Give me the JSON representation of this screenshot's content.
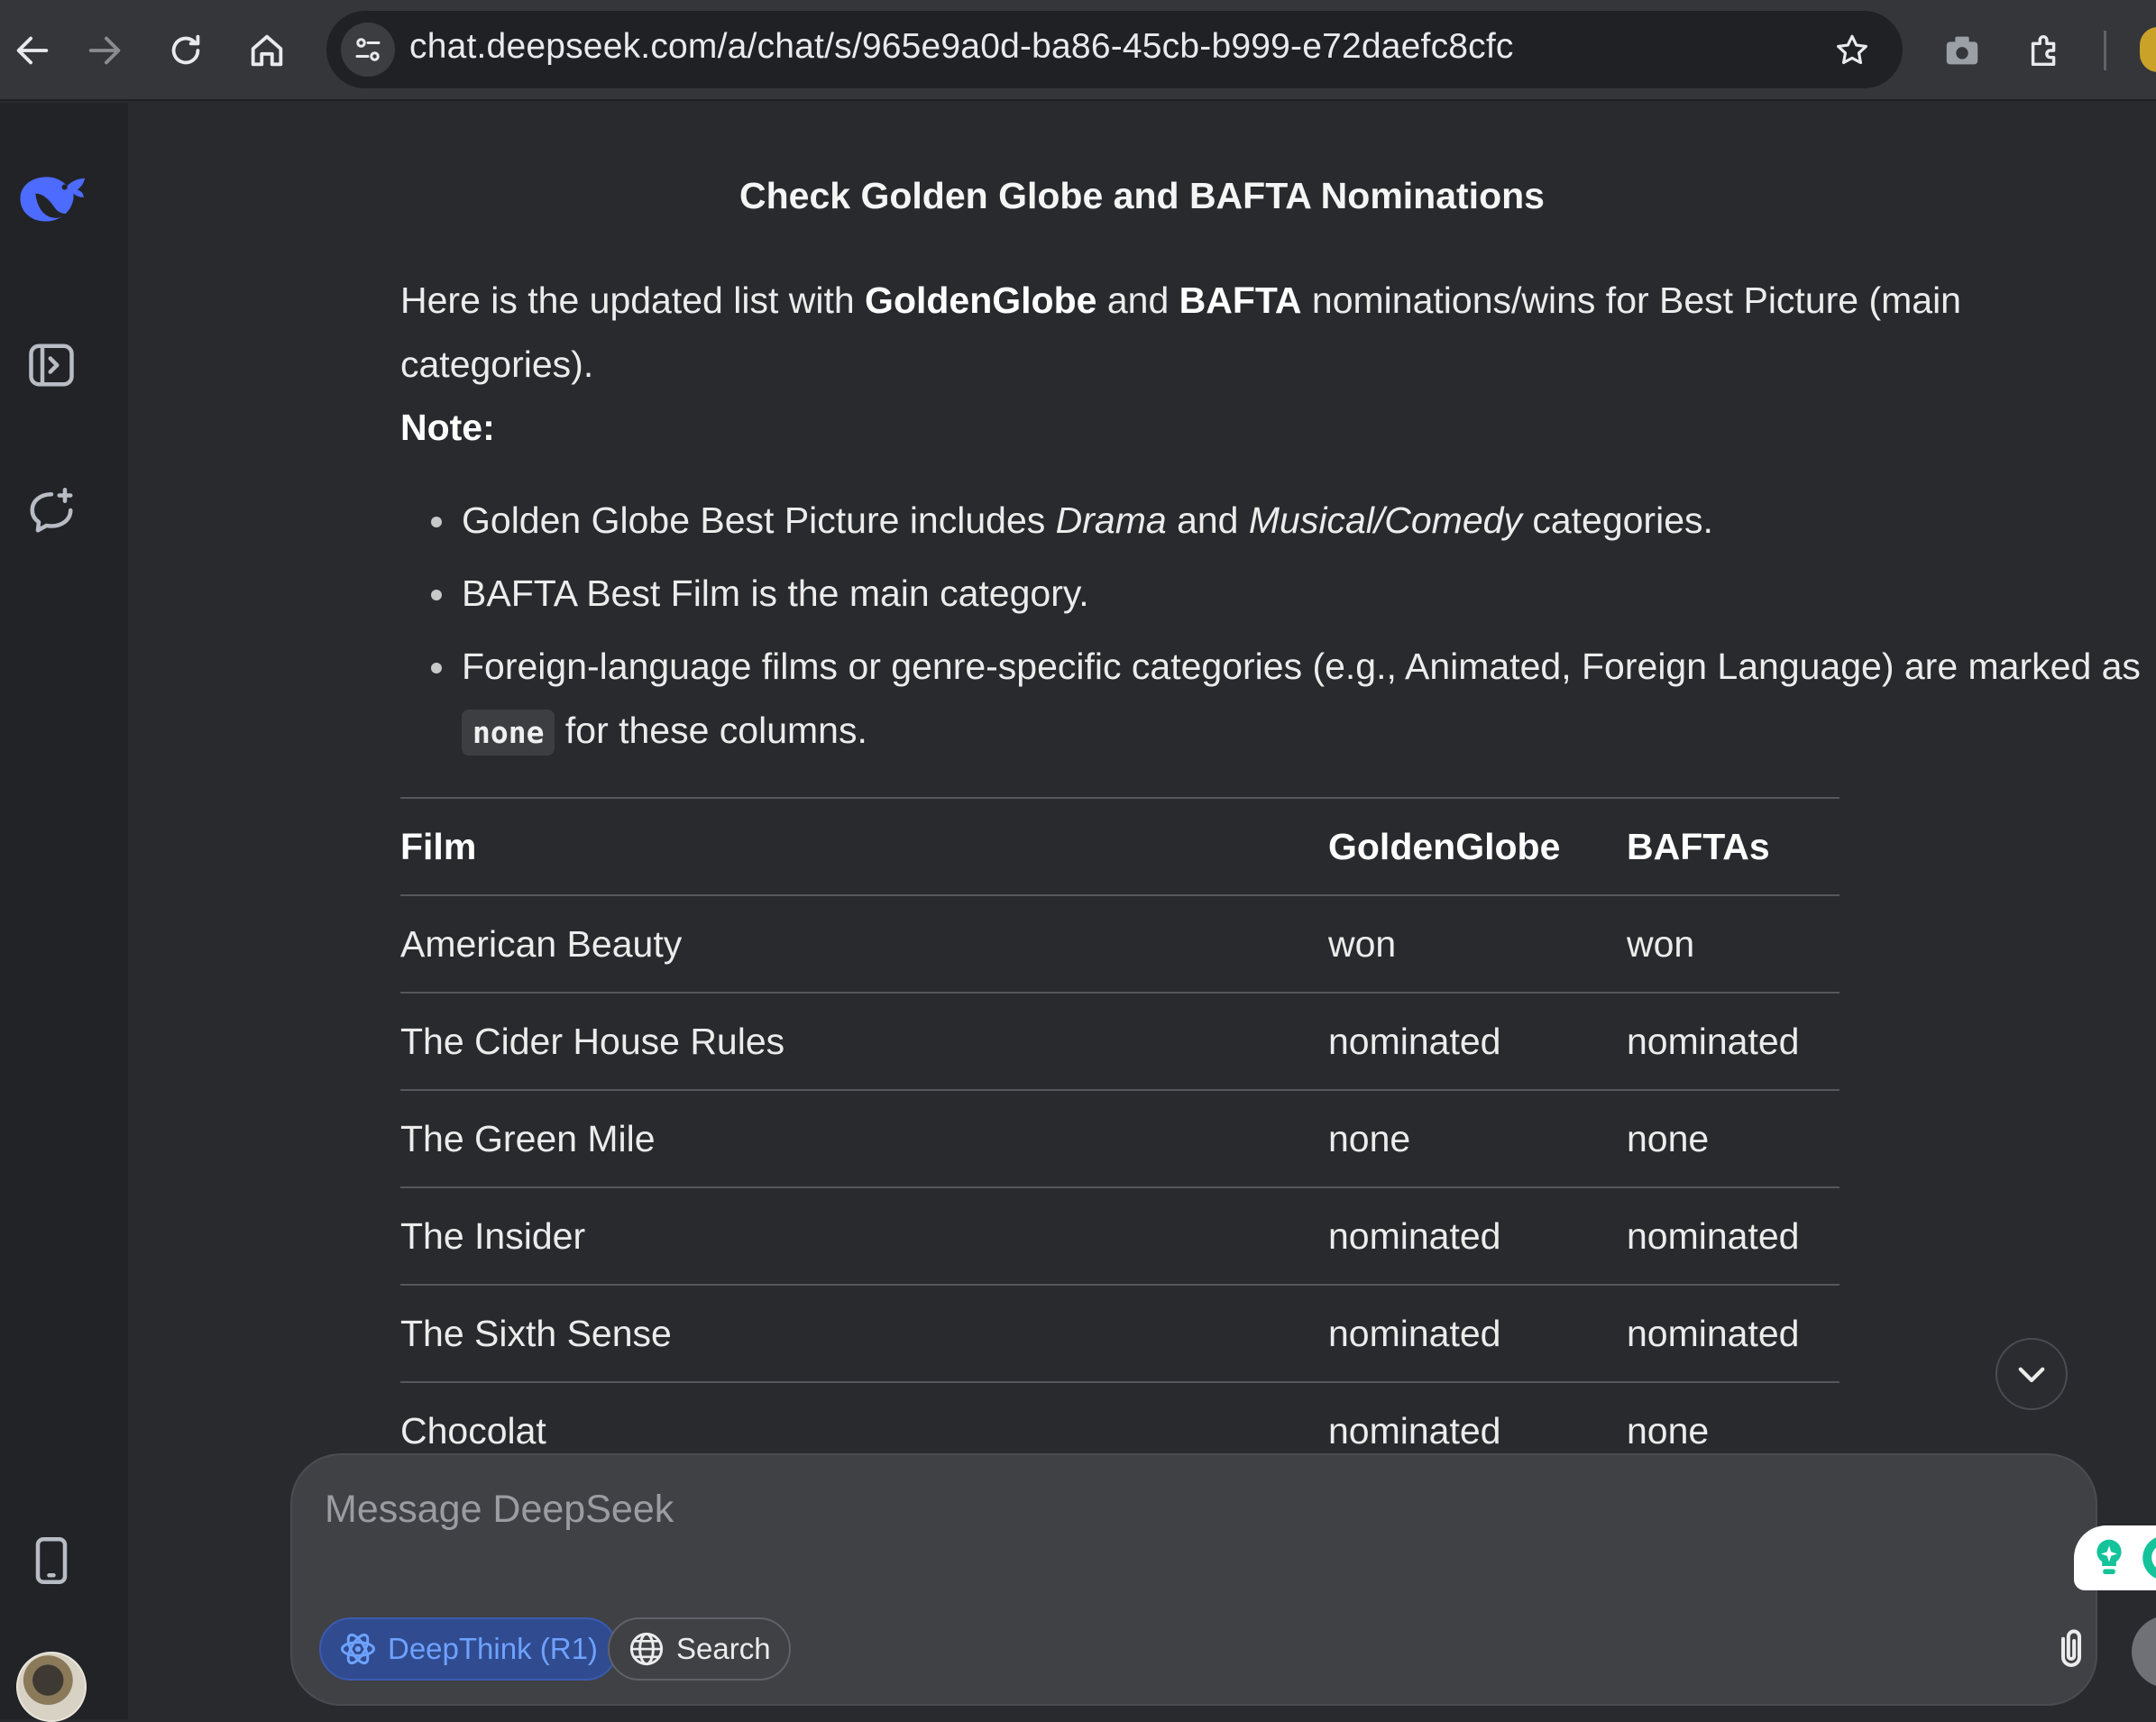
{
  "browser": {
    "url": "chat.deepseek.com/a/chat/s/965e9a0d-ba86-45cb-b999-e72daefc8cfc"
  },
  "chat": {
    "title": "Check Golden Globe and BAFTA Nominations",
    "intro_prefix": "Here is the updated list with ",
    "intro_bold1": "GoldenGlobe",
    "intro_and": " and ",
    "intro_bold2": "BAFTA",
    "intro_suffix": " nominations/wins for Best Picture (main categories).",
    "note_label": "Note:",
    "bullet1_a": "Golden Globe Best Picture includes ",
    "bullet1_i1": "Drama",
    "bullet1_b": " and ",
    "bullet1_i2": "Musical/Comedy",
    "bullet1_c": " categories.",
    "bullet2": "BAFTA Best Film is the main category.",
    "bullet3_a": "Foreign-language films or genre-specific categories (e.g., Animated, Foreign Language) are marked as ",
    "bullet3_code": "none",
    "bullet3_b": " for these columns."
  },
  "table": {
    "headers": [
      "Film",
      "GoldenGlobe",
      "BAFTAs"
    ],
    "rows": [
      [
        "American Beauty",
        "won",
        "won"
      ],
      [
        "The Cider House Rules",
        "nominated",
        "nominated"
      ],
      [
        "The Green Mile",
        "none",
        "none"
      ],
      [
        "The Insider",
        "nominated",
        "nominated"
      ],
      [
        "The Sixth Sense",
        "nominated",
        "nominated"
      ],
      [
        "Chocolat",
        "nominated",
        "none"
      ]
    ]
  },
  "composer": {
    "placeholder": "Message DeepSeek",
    "deepthink_label": "DeepThink (R1)",
    "search_label": "Search"
  },
  "colors": {
    "accent": "#4d6bfe",
    "background": "#292a2d",
    "sidebar": "#212327"
  },
  "icons": {
    "sidebar": [
      "deepseek-logo-icon",
      "open-sidebar-icon",
      "new-chat-icon",
      "mobile-app-icon"
    ],
    "composer": [
      "atom-icon",
      "globe-icon",
      "paperclip-icon",
      "arrow-up-icon"
    ]
  }
}
